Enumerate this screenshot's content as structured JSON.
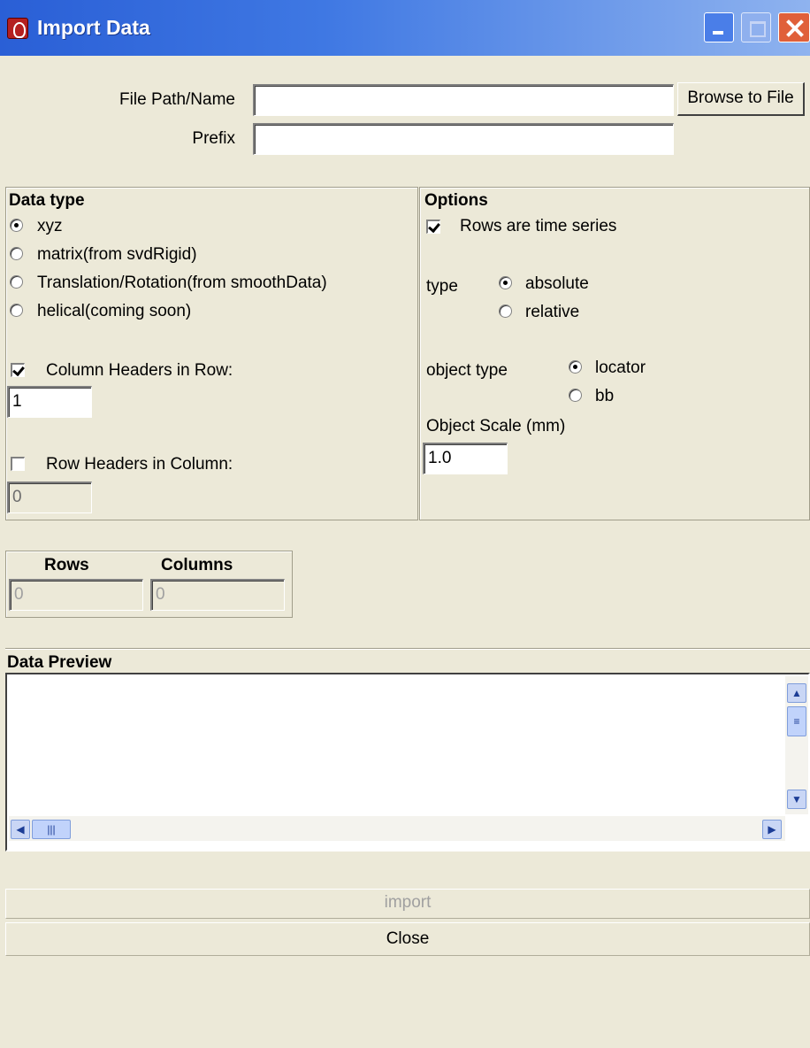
{
  "window": {
    "title": "Import Data"
  },
  "file": {
    "path_label": "File Path/Name",
    "path_value": "",
    "browse_label": "Browse to File",
    "prefix_label": "Prefix",
    "prefix_value": ""
  },
  "data_type": {
    "heading": "Data type",
    "options": [
      {
        "label": "xyz",
        "selected": true
      },
      {
        "label": "matrix(from svdRigid)",
        "selected": false
      },
      {
        "label": "Translation/Rotation(from smoothData)",
        "selected": false
      },
      {
        "label": "helical(coming soon)",
        "selected": false
      }
    ],
    "column_headers_label": "Column Headers in Row:",
    "column_headers_checked": true,
    "column_headers_value": "1",
    "row_headers_label": "Row Headers in Column:",
    "row_headers_checked": false,
    "row_headers_value": "0"
  },
  "options": {
    "heading": "Options",
    "time_series_label": "Rows are time series",
    "time_series_checked": true,
    "type_label": "type",
    "type_options": [
      {
        "label": "absolute",
        "selected": true
      },
      {
        "label": "relative",
        "selected": false
      }
    ],
    "object_type_label": "object type",
    "object_type_options": [
      {
        "label": "locator",
        "selected": true
      },
      {
        "label": "bb",
        "selected": false
      }
    ],
    "scale_label": "Object Scale (mm)",
    "scale_value": "1.0"
  },
  "counts": {
    "rows_label": "Rows",
    "rows_value": "0",
    "columns_label": "Columns",
    "columns_value": "0"
  },
  "preview": {
    "heading": "Data Preview",
    "content": ""
  },
  "actions": {
    "import_label": "import",
    "close_label": "Close"
  }
}
